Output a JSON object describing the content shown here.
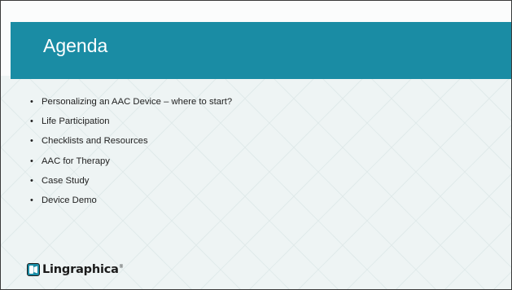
{
  "slide": {
    "title": "Agenda",
    "bullets": [
      "Personalizing an AAC Device – where to start?",
      "Life Participation",
      "Checklists and Resources",
      "AAC for Therapy",
      "Case Study",
      "Device Demo"
    ],
    "bullet_glyph": "•"
  },
  "logo": {
    "text": "Lingraphica",
    "registered": "®",
    "icon": "lingraphica-logo-icon"
  },
  "colors": {
    "accent": "#1a8ca4",
    "background": "#eef4f4",
    "text": "#222222"
  }
}
